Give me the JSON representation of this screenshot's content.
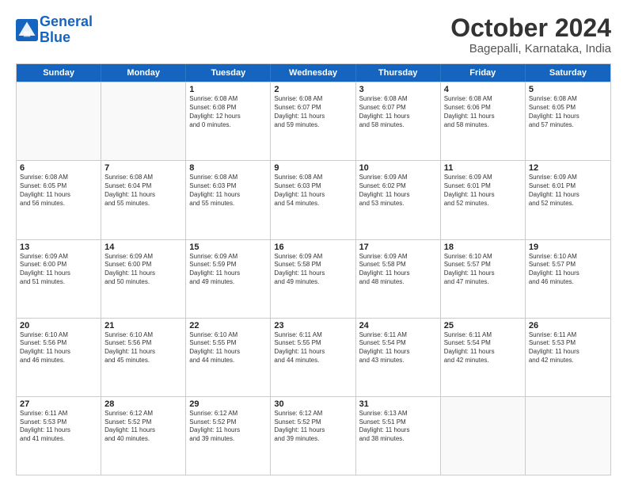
{
  "header": {
    "logo_line1": "General",
    "logo_line2": "Blue",
    "month_title": "October 2024",
    "location": "Bagepalli, Karnataka, India"
  },
  "weekdays": [
    "Sunday",
    "Monday",
    "Tuesday",
    "Wednesday",
    "Thursday",
    "Friday",
    "Saturday"
  ],
  "weeks": [
    [
      {
        "day": "",
        "info": ""
      },
      {
        "day": "",
        "info": ""
      },
      {
        "day": "1",
        "info": "Sunrise: 6:08 AM\nSunset: 6:08 PM\nDaylight: 12 hours\nand 0 minutes."
      },
      {
        "day": "2",
        "info": "Sunrise: 6:08 AM\nSunset: 6:07 PM\nDaylight: 11 hours\nand 59 minutes."
      },
      {
        "day": "3",
        "info": "Sunrise: 6:08 AM\nSunset: 6:07 PM\nDaylight: 11 hours\nand 58 minutes."
      },
      {
        "day": "4",
        "info": "Sunrise: 6:08 AM\nSunset: 6:06 PM\nDaylight: 11 hours\nand 58 minutes."
      },
      {
        "day": "5",
        "info": "Sunrise: 6:08 AM\nSunset: 6:05 PM\nDaylight: 11 hours\nand 57 minutes."
      }
    ],
    [
      {
        "day": "6",
        "info": "Sunrise: 6:08 AM\nSunset: 6:05 PM\nDaylight: 11 hours\nand 56 minutes."
      },
      {
        "day": "7",
        "info": "Sunrise: 6:08 AM\nSunset: 6:04 PM\nDaylight: 11 hours\nand 55 minutes."
      },
      {
        "day": "8",
        "info": "Sunrise: 6:08 AM\nSunset: 6:03 PM\nDaylight: 11 hours\nand 55 minutes."
      },
      {
        "day": "9",
        "info": "Sunrise: 6:08 AM\nSunset: 6:03 PM\nDaylight: 11 hours\nand 54 minutes."
      },
      {
        "day": "10",
        "info": "Sunrise: 6:09 AM\nSunset: 6:02 PM\nDaylight: 11 hours\nand 53 minutes."
      },
      {
        "day": "11",
        "info": "Sunrise: 6:09 AM\nSunset: 6:01 PM\nDaylight: 11 hours\nand 52 minutes."
      },
      {
        "day": "12",
        "info": "Sunrise: 6:09 AM\nSunset: 6:01 PM\nDaylight: 11 hours\nand 52 minutes."
      }
    ],
    [
      {
        "day": "13",
        "info": "Sunrise: 6:09 AM\nSunset: 6:00 PM\nDaylight: 11 hours\nand 51 minutes."
      },
      {
        "day": "14",
        "info": "Sunrise: 6:09 AM\nSunset: 6:00 PM\nDaylight: 11 hours\nand 50 minutes."
      },
      {
        "day": "15",
        "info": "Sunrise: 6:09 AM\nSunset: 5:59 PM\nDaylight: 11 hours\nand 49 minutes."
      },
      {
        "day": "16",
        "info": "Sunrise: 6:09 AM\nSunset: 5:58 PM\nDaylight: 11 hours\nand 49 minutes."
      },
      {
        "day": "17",
        "info": "Sunrise: 6:09 AM\nSunset: 5:58 PM\nDaylight: 11 hours\nand 48 minutes."
      },
      {
        "day": "18",
        "info": "Sunrise: 6:10 AM\nSunset: 5:57 PM\nDaylight: 11 hours\nand 47 minutes."
      },
      {
        "day": "19",
        "info": "Sunrise: 6:10 AM\nSunset: 5:57 PM\nDaylight: 11 hours\nand 46 minutes."
      }
    ],
    [
      {
        "day": "20",
        "info": "Sunrise: 6:10 AM\nSunset: 5:56 PM\nDaylight: 11 hours\nand 46 minutes."
      },
      {
        "day": "21",
        "info": "Sunrise: 6:10 AM\nSunset: 5:56 PM\nDaylight: 11 hours\nand 45 minutes."
      },
      {
        "day": "22",
        "info": "Sunrise: 6:10 AM\nSunset: 5:55 PM\nDaylight: 11 hours\nand 44 minutes."
      },
      {
        "day": "23",
        "info": "Sunrise: 6:11 AM\nSunset: 5:55 PM\nDaylight: 11 hours\nand 44 minutes."
      },
      {
        "day": "24",
        "info": "Sunrise: 6:11 AM\nSunset: 5:54 PM\nDaylight: 11 hours\nand 43 minutes."
      },
      {
        "day": "25",
        "info": "Sunrise: 6:11 AM\nSunset: 5:54 PM\nDaylight: 11 hours\nand 42 minutes."
      },
      {
        "day": "26",
        "info": "Sunrise: 6:11 AM\nSunset: 5:53 PM\nDaylight: 11 hours\nand 42 minutes."
      }
    ],
    [
      {
        "day": "27",
        "info": "Sunrise: 6:11 AM\nSunset: 5:53 PM\nDaylight: 11 hours\nand 41 minutes."
      },
      {
        "day": "28",
        "info": "Sunrise: 6:12 AM\nSunset: 5:52 PM\nDaylight: 11 hours\nand 40 minutes."
      },
      {
        "day": "29",
        "info": "Sunrise: 6:12 AM\nSunset: 5:52 PM\nDaylight: 11 hours\nand 39 minutes."
      },
      {
        "day": "30",
        "info": "Sunrise: 6:12 AM\nSunset: 5:52 PM\nDaylight: 11 hours\nand 39 minutes."
      },
      {
        "day": "31",
        "info": "Sunrise: 6:13 AM\nSunset: 5:51 PM\nDaylight: 11 hours\nand 38 minutes."
      },
      {
        "day": "",
        "info": ""
      },
      {
        "day": "",
        "info": ""
      }
    ]
  ]
}
